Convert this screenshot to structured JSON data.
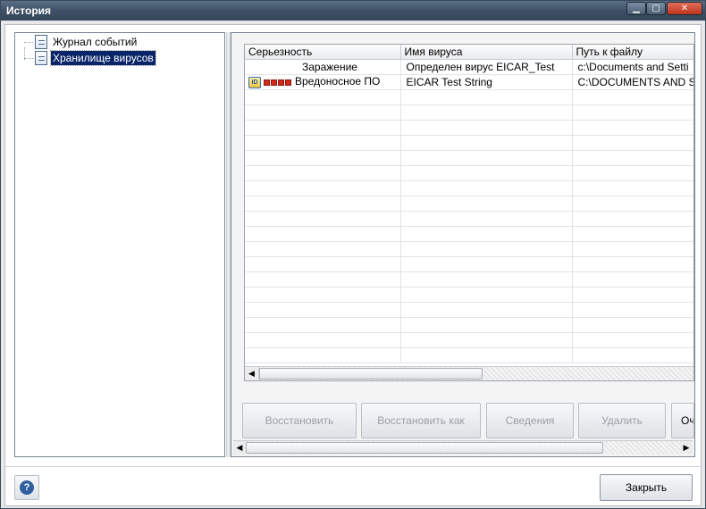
{
  "window": {
    "title": "История",
    "min_icon": "minimize-icon",
    "max_icon": "maximize-icon",
    "close_icon": "close-icon",
    "min_glyph": "▁",
    "max_glyph": "▢",
    "close_glyph": "✕"
  },
  "tree": {
    "items": [
      {
        "label": "Журнал событий",
        "icon": "journal-icon",
        "selected": false
      },
      {
        "label": "Хранилище вирусов",
        "icon": "storage-icon",
        "selected": true
      }
    ]
  },
  "table": {
    "columns": [
      "Серьезность",
      "Имя вируса",
      "Путь к файлу"
    ],
    "rows": [
      {
        "severity": "Заражение",
        "name": "Определен вирус EICAR_Test",
        "path": "c:\\Documents and Setti",
        "has_icon": false
      },
      {
        "severity": "Вредоносное ПО",
        "name": "EICAR Test String",
        "path": "C:\\DOCUMENTS AND SE",
        "has_icon": true,
        "badge": "ID",
        "severity_level": 4
      }
    ]
  },
  "buttons": {
    "restore": "Восстановить",
    "restore_as": "Восстановить как",
    "details": "Сведения",
    "delete": "Удалить",
    "clear": "Оч"
  },
  "footer": {
    "help_glyph": "?",
    "close_label": "Закрыть"
  },
  "scroll": {
    "left_glyph": "◀",
    "right_glyph": "▶"
  }
}
